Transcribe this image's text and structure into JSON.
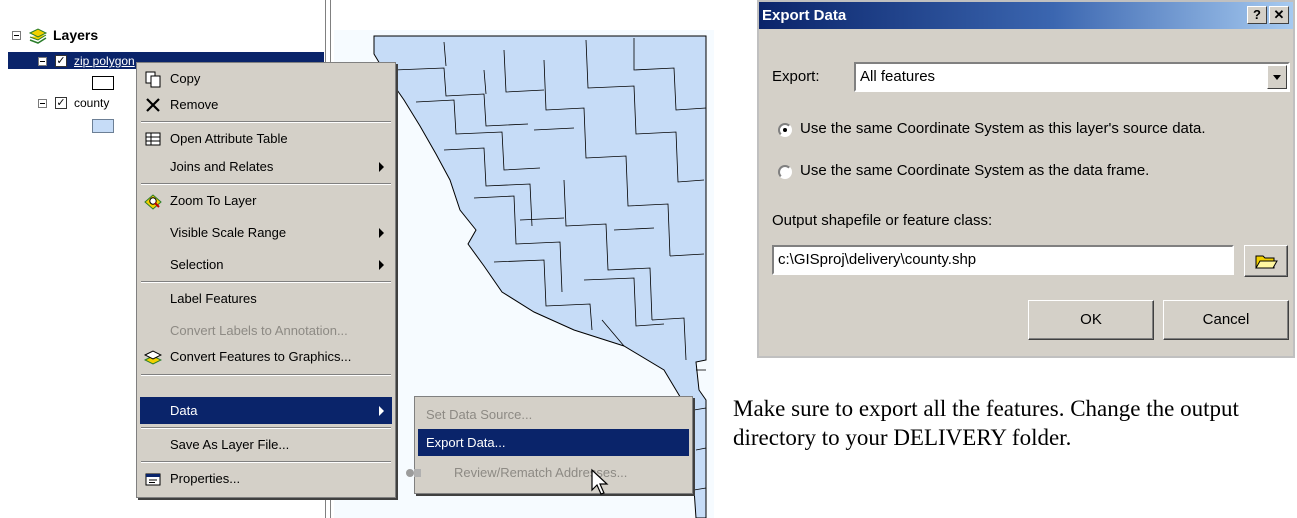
{
  "toc": {
    "root_label": "Layers",
    "layers": [
      {
        "name": "zip polygon",
        "checked": true,
        "selected": true
      },
      {
        "name": "county",
        "checked": true,
        "selected": false
      }
    ]
  },
  "context_menu": {
    "items": [
      {
        "label": "Copy",
        "icon": "copy-icon"
      },
      {
        "label": "Remove",
        "icon": "remove-x-icon"
      },
      {
        "label": "Open Attribute Table",
        "icon": "table-icon"
      },
      {
        "label": "Joins and Relates",
        "submenu": true
      },
      {
        "label": "Zoom To Layer",
        "icon": "zoom-to-layer-icon"
      },
      {
        "label": "Visible Scale Range",
        "submenu": true
      },
      {
        "label": "Selection",
        "submenu": true
      },
      {
        "label": "Label Features"
      },
      {
        "label": "Convert Labels to Annotation...",
        "disabled": true
      },
      {
        "label": "Convert Features to Graphics...",
        "icon": "convert-graphics-icon"
      },
      {
        "label": "Data",
        "submenu": true,
        "highlighted": true
      },
      {
        "label": "Save As Layer File..."
      },
      {
        "label": "Properties...",
        "icon": "properties-icon"
      }
    ]
  },
  "data_submenu": {
    "items": [
      {
        "label": "Set Data Source...",
        "disabled": true
      },
      {
        "label": "Export Data...",
        "highlighted": true
      },
      {
        "label": "Review/Rematch Addresses...",
        "disabled": true
      }
    ]
  },
  "export_dialog": {
    "title": "Export Data",
    "help_button": "?",
    "close_button": "✕",
    "export_label": "Export:",
    "export_value": "All features",
    "option_source": "Use the same Coordinate System as this layer's source data.",
    "option_frame": "Use the same Coordinate System as the data frame.",
    "output_label": "Output shapefile or feature class:",
    "output_value": "c:\\GISproj\\delivery\\county.shp",
    "ok_label": "OK",
    "cancel_label": "Cancel"
  },
  "instruction": "Make sure to export all the features.  Change the output directory to your DELIVERY folder.",
  "colors": {
    "selection": "#0a246a",
    "county_fill": "#c6dcf7",
    "county_stroke": "#000000",
    "menu_bg": "#d4d0c8"
  }
}
